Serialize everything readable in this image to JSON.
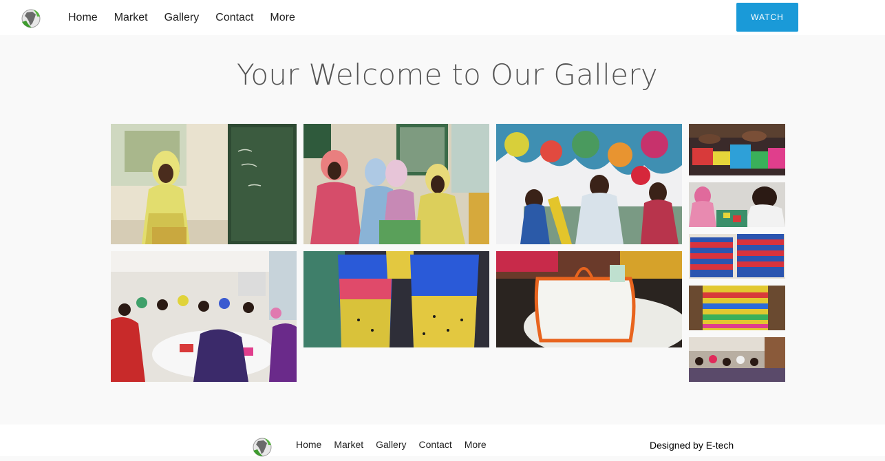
{
  "header": {
    "logo_icon": "africa-globe-logo-icon",
    "nav": [
      "Home",
      "Market",
      "Gallery",
      "Contact",
      "More"
    ],
    "watch_label": "WATCH",
    "accent_color": "#1a9ad8"
  },
  "main": {
    "title": "Your Welcome to Our Gallery",
    "photos": [
      {
        "name": "photo-woman-yellow-scarf"
      },
      {
        "name": "photo-women-knitting-outdoors"
      },
      {
        "name": "photo-colorful-plastic-bags"
      },
      {
        "name": "photo-workshop-tables"
      },
      {
        "name": "photo-striped-baskets"
      },
      {
        "name": "photo-white-crochet-bag"
      },
      {
        "name": "photo-hands-sorting"
      },
      {
        "name": "photo-group-crafting"
      },
      {
        "name": "photo-red-blue-bags"
      },
      {
        "name": "photo-patterned-bag"
      },
      {
        "name": "photo-hall-crowd"
      }
    ]
  },
  "footer": {
    "logo_icon": "africa-globe-logo-icon",
    "nav": [
      "Home",
      "Market",
      "Gallery",
      "Contact",
      "More"
    ],
    "credit": "Designed by E-tech"
  }
}
